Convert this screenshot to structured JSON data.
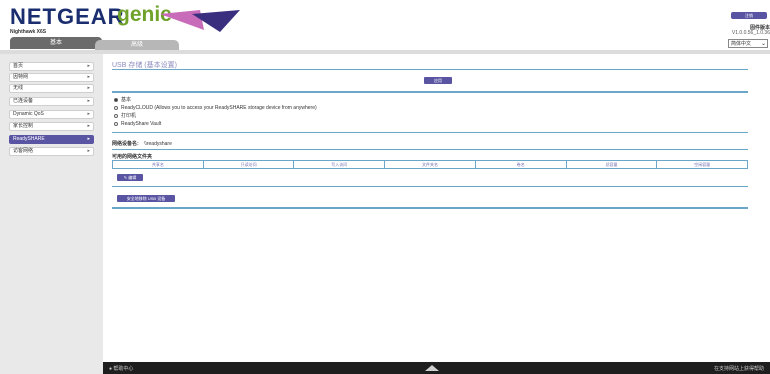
{
  "header": {
    "brand": "NETGEAR",
    "product": "genie",
    "model": "Nighthawk X6S",
    "logout_label": "注销",
    "firmware_label": "固件版本",
    "firmware_version": "V1.0.0.56_1.0.36",
    "language": "简体中文"
  },
  "tabs": {
    "basic": "基本",
    "advanced": "高级"
  },
  "sidebar": {
    "items": [
      {
        "label": "首页"
      },
      {
        "label": "因特网"
      },
      {
        "label": "无线"
      },
      {
        "label": "已连设备"
      },
      {
        "label": "Dynamic QoS"
      },
      {
        "label": "家长控制"
      },
      {
        "label": "ReadySHARE"
      },
      {
        "label": "访客网络"
      }
    ],
    "active_index": 6
  },
  "main": {
    "title": "USB 存储 (基本设置)",
    "apply_label": "应用",
    "access_options": [
      {
        "label": "基本",
        "selected": true
      },
      {
        "label": "ReadyCLOUD (Allows you to access your ReadySHARE storage device from anywhere)",
        "selected": false
      },
      {
        "label": "打印机",
        "selected": false
      },
      {
        "label": "ReadyShare Vault",
        "selected": false
      }
    ],
    "network_device_label": "网络设备名:",
    "network_device_name": "\\\\readyshare",
    "table_caption": "可用的网络文件夹",
    "table_headers": [
      "共享名",
      "只读访问",
      "写入访问",
      "文件夹名",
      "卷名",
      "总容量",
      "空闲容量"
    ],
    "edit_label": "编辑",
    "safe_remove_label": "安全地移除 USB 设备"
  },
  "footer": {
    "help_label": "帮助中心",
    "support_label": "在支持网站上获得帮助"
  },
  "colors": {
    "accent": "#5a55a3",
    "brand_blue": "#1a2d6e",
    "brand_green": "#6fa22b",
    "rule": "#6aa6c8"
  }
}
